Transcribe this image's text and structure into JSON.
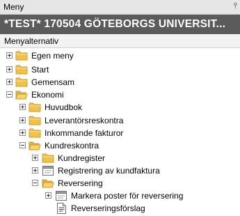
{
  "window": {
    "title": "Meny",
    "pin_glyph": "⫯"
  },
  "banner": {
    "text": "*TEST* 170504 GÖTEBORGS UNIVERSIT..."
  },
  "section": {
    "label": "Menyalternativ"
  },
  "tree": {
    "egen_meny": "Egen meny",
    "start": "Start",
    "gemensam": "Gemensam",
    "ekonomi": "Ekonomi",
    "huvudbok": "Huvudbok",
    "leverantorsreskontra": "Leverantörsreskontra",
    "inkommande": "Inkommande fakturor",
    "kundreskontra": "Kundreskontra",
    "kundregister": "Kundregister",
    "registrering": "Registrering av kundfaktura",
    "reversering": "Reversering",
    "markera": "Markera poster för reversering",
    "forslag": "Reverseringsförslag"
  },
  "colors": {
    "folder": "#f0c14b",
    "banner_bg": "#5b5b5b"
  }
}
